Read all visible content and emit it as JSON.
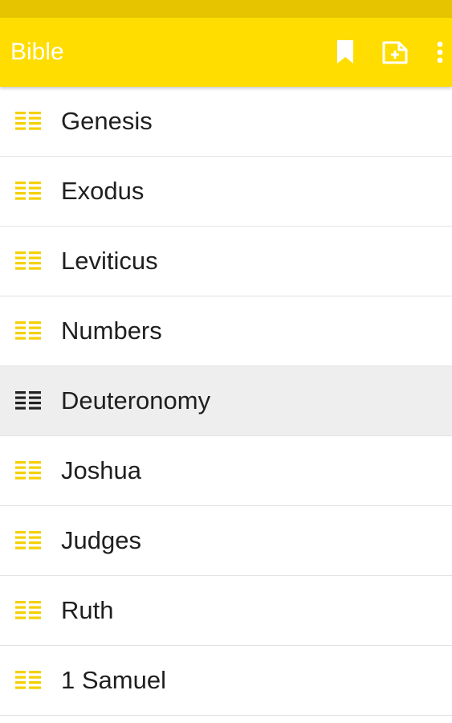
{
  "app_bar": {
    "title": "Bible",
    "background_color": "#FFDD00",
    "status_bar_color": "#E6C400",
    "actions": [
      {
        "icon": "bookmark-icon"
      },
      {
        "icon": "add-note-icon"
      },
      {
        "icon": "more-vert-icon"
      }
    ]
  },
  "books": [
    {
      "label": "Genesis",
      "selected": false
    },
    {
      "label": "Exodus",
      "selected": false
    },
    {
      "label": "Leviticus",
      "selected": false
    },
    {
      "label": "Numbers",
      "selected": false
    },
    {
      "label": "Deuteronomy",
      "selected": true
    },
    {
      "label": "Joshua",
      "selected": false
    },
    {
      "label": "Judges",
      "selected": false
    },
    {
      "label": "Ruth",
      "selected": false
    },
    {
      "label": "1 Samuel",
      "selected": false
    }
  ],
  "colors": {
    "icon_default": "#F5D000",
    "icon_selected": "#222222",
    "selected_row_bg": "#EEEEEE",
    "divider": "#E2E2E2"
  }
}
